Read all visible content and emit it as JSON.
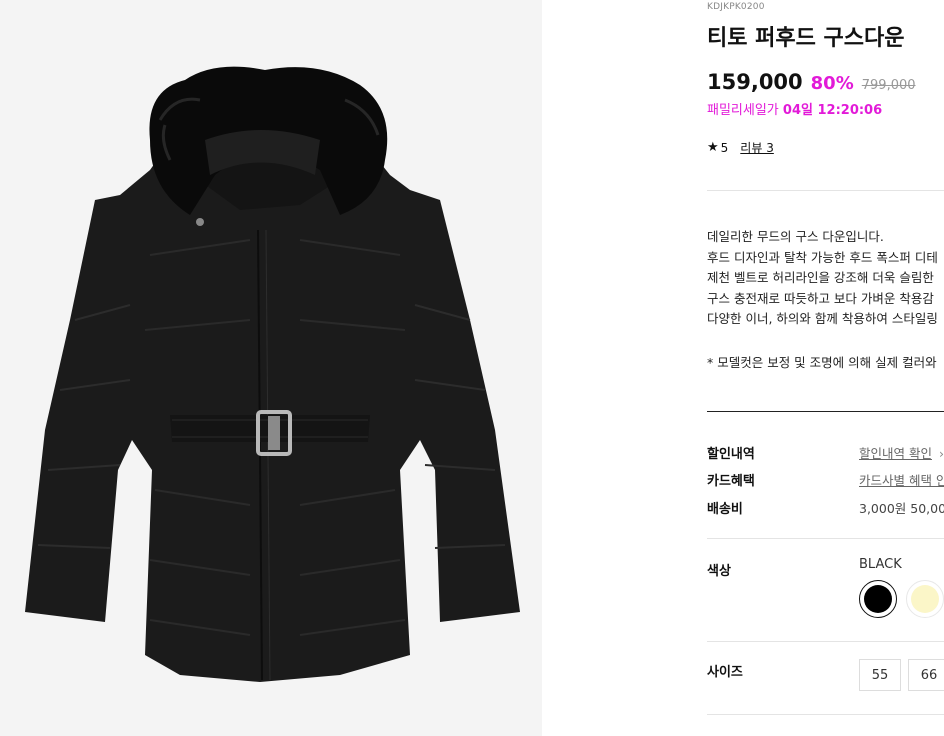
{
  "product": {
    "code": "KDJKPK0200",
    "title": "티토 퍼후드 구스다운",
    "price": "159,000",
    "discount": "80%",
    "original_price": "799,000",
    "sale_label": "패밀리세일가",
    "sale_time": "04일 12:20:06",
    "rating_star": "★",
    "rating": "5",
    "review_label": "리뷰 3"
  },
  "description": {
    "lines": [
      "데일리한 무드의 구스 다운입니다.",
      "후드 디자인과 탈착 가능한 후드 폭스퍼 디테",
      "제천 벨트로 허리라인을 강조해 더욱 슬림한",
      "구스 충전재로 따듯하고 보다 가벼운 착용감",
      "다양한 이너, 하의와 함께 착용하여 스타일링"
    ],
    "note": "* 모델컷은 보정 및 조명에 의해 실제 컬러와"
  },
  "benefits": {
    "discount_label": "할인내역",
    "discount_link": "할인내역 확인",
    "discount_chevron": "›",
    "card_label": "카드혜택",
    "card_link": "카드사별 혜택 안",
    "shipping_label": "배송비",
    "shipping_value": "3,000원 50,00"
  },
  "options": {
    "color_label": "색상",
    "selected_color": "BLACK",
    "colors": [
      {
        "name": "BLACK",
        "hex": "#000000"
      },
      {
        "name": "cream",
        "hex": "#fbf6c8"
      }
    ],
    "size_label": "사이즈",
    "sizes": [
      "55",
      "66"
    ]
  },
  "theme": {
    "accent": "#e21ad8",
    "image_bg": "#f4f4f4"
  }
}
